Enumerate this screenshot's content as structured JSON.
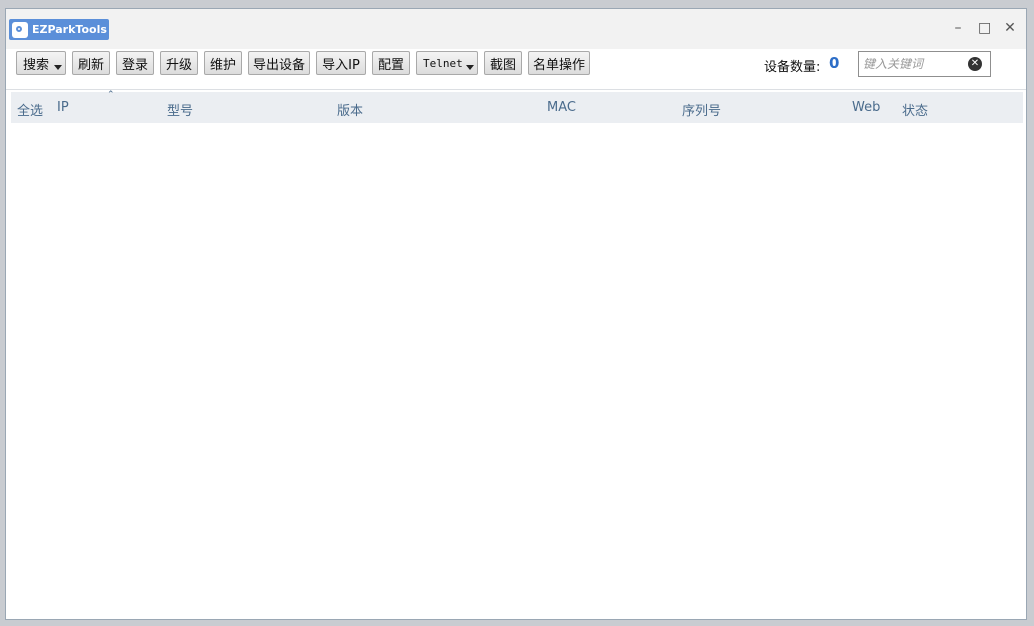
{
  "app": {
    "title": "EZParkTools",
    "window_controls": {
      "minimize": "–",
      "maximize": "□",
      "close": "✕"
    }
  },
  "toolbar": {
    "buttons": [
      {
        "id": "search",
        "label": "搜索",
        "dropdown": true
      },
      {
        "id": "refresh",
        "label": "刷新",
        "dropdown": false
      },
      {
        "id": "login",
        "label": "登录",
        "dropdown": false
      },
      {
        "id": "upgrade",
        "label": "升级",
        "dropdown": false
      },
      {
        "id": "maintain",
        "label": "维护",
        "dropdown": false
      },
      {
        "id": "export",
        "label": "导出设备",
        "dropdown": false
      },
      {
        "id": "import-ip",
        "label": "导入IP",
        "dropdown": false
      },
      {
        "id": "config",
        "label": "配置",
        "dropdown": false
      },
      {
        "id": "telnet",
        "label": "Telnet",
        "dropdown": true
      },
      {
        "id": "screenshot",
        "label": "截图",
        "dropdown": false
      },
      {
        "id": "list-ops",
        "label": "名单操作",
        "dropdown": false
      }
    ],
    "device_count_label": "设备数量:",
    "device_count_value": "0",
    "search_placeholder": "键入关键词"
  },
  "table": {
    "columns": [
      "全选",
      "IP",
      "型号",
      "版本",
      "MAC",
      "序列号",
      "Web",
      "状态"
    ],
    "sorted_column": "IP",
    "rows": []
  },
  "colors": {
    "accent": "#2d6ec7",
    "logo_bg": "#5b8fd9",
    "header_bg": "#ebeef2",
    "header_text": "#4a6b8c"
  }
}
